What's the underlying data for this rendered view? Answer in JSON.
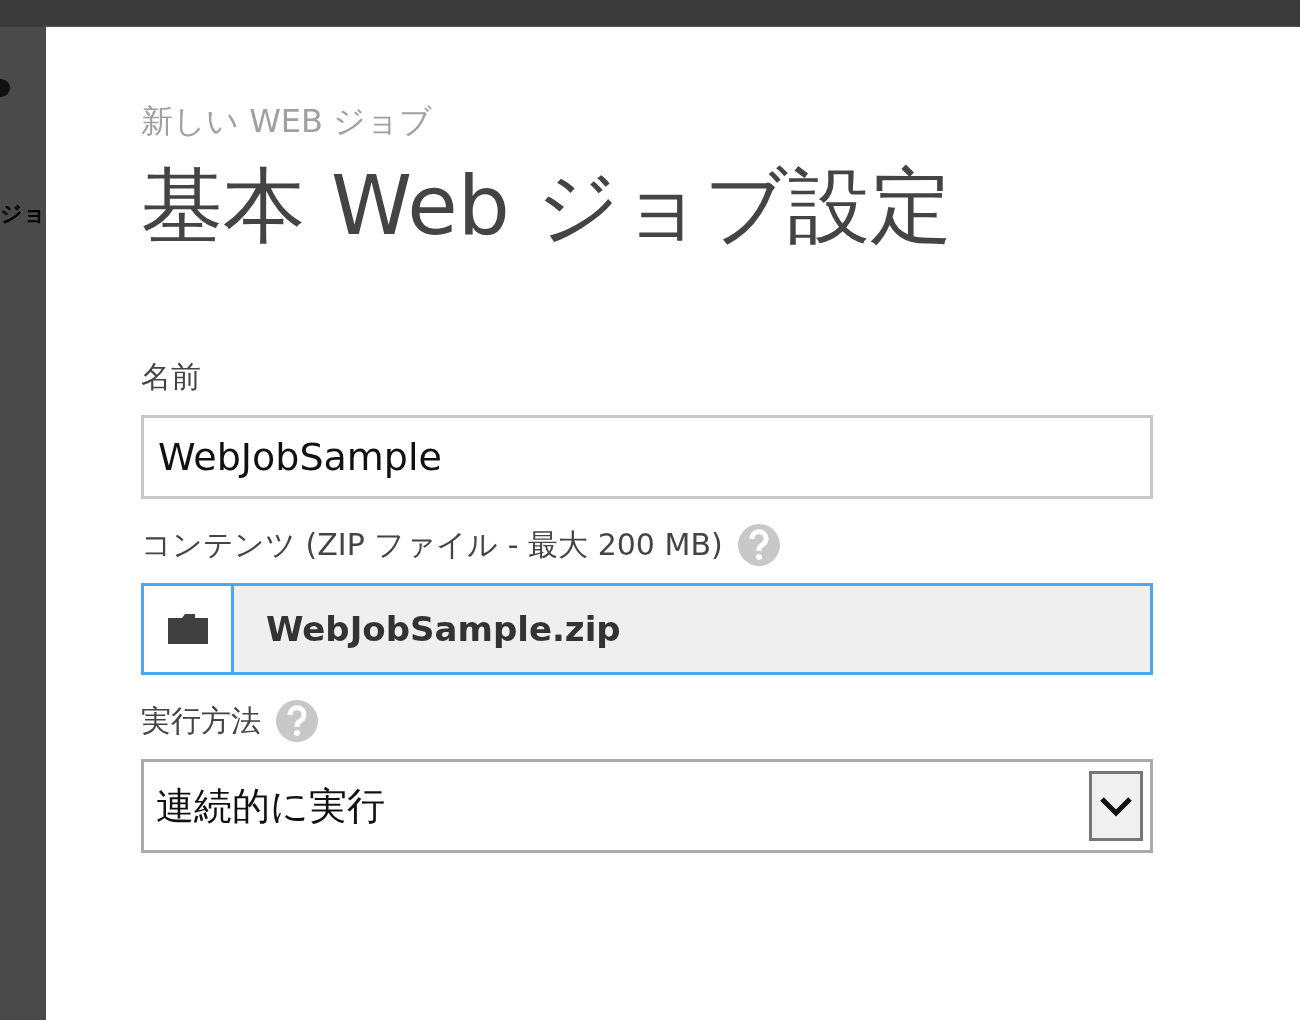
{
  "background_page": {
    "partial_text": "ジョ"
  },
  "dialog": {
    "subtitle": "新しい WEB ジョブ",
    "title": "基本 Web ジョブ設定",
    "fields": [
      {
        "kind": "text",
        "label": "名前",
        "help": false,
        "value": "WebJobSample"
      },
      {
        "kind": "file",
        "label": "コンテンツ (ZIP ファイル - 最大 200 MB)",
        "help": true,
        "value": "WebJobSample.zip",
        "focused": true
      },
      {
        "kind": "select",
        "label": "実行方法",
        "help": true,
        "value": "連続的に実行"
      }
    ]
  }
}
